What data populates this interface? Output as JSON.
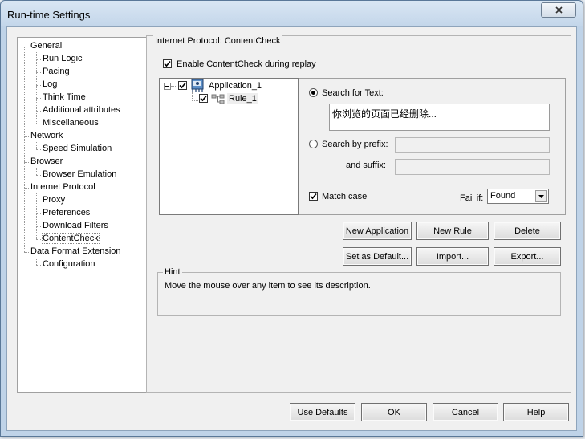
{
  "window": {
    "title": "Run-time Settings"
  },
  "nav": {
    "items": [
      {
        "label": "General",
        "level": 0
      },
      {
        "label": "Run Logic",
        "level": 1
      },
      {
        "label": "Pacing",
        "level": 1
      },
      {
        "label": "Log",
        "level": 1
      },
      {
        "label": "Think Time",
        "level": 1
      },
      {
        "label": "Additional attributes",
        "level": 1
      },
      {
        "label": "Miscellaneous",
        "level": 1
      },
      {
        "label": "Network",
        "level": 0
      },
      {
        "label": "Speed Simulation",
        "level": 1
      },
      {
        "label": "Browser",
        "level": 0
      },
      {
        "label": "Browser Emulation",
        "level": 1
      },
      {
        "label": "Internet Protocol",
        "level": 0
      },
      {
        "label": "Proxy",
        "level": 1
      },
      {
        "label": "Preferences",
        "level": 1
      },
      {
        "label": "Download Filters",
        "level": 1
      },
      {
        "label": "ContentCheck",
        "level": 1,
        "selected": true
      },
      {
        "label": "Data Format Extension",
        "level": 0
      },
      {
        "label": "Configuration",
        "level": 1
      }
    ]
  },
  "panel": {
    "group_title": "Internet Protocol: ContentCheck",
    "enable_label": "Enable ContentCheck during replay",
    "enable_checked": true
  },
  "rules_tree": {
    "application": {
      "label": "Application_1",
      "checked": true,
      "icon": "application-icon"
    },
    "rule": {
      "label": "Rule_1",
      "checked": true,
      "icon": "rule-icon"
    }
  },
  "search": {
    "search_text_label": "Search for Text:",
    "search_text_value": "你浏览的页面已经删除...",
    "search_text_selected": true,
    "prefix_label": "Search by prefix:",
    "prefix_value": "",
    "suffix_label": "and suffix:",
    "suffix_value": "",
    "match_case_label": "Match case",
    "match_case_checked": true,
    "fail_if_label": "Fail if:",
    "fail_if_value": "Found"
  },
  "buttons": {
    "new_application": "New Application",
    "new_rule": "New Rule",
    "delete": "Delete",
    "set_as_default": "Set as Default...",
    "import": "Import...",
    "export": "Export..."
  },
  "hint": {
    "title": "Hint",
    "text": "Move the mouse over any item to see its description."
  },
  "footer": {
    "use_defaults": "Use Defaults",
    "ok": "OK",
    "cancel": "Cancel",
    "help": "Help"
  }
}
